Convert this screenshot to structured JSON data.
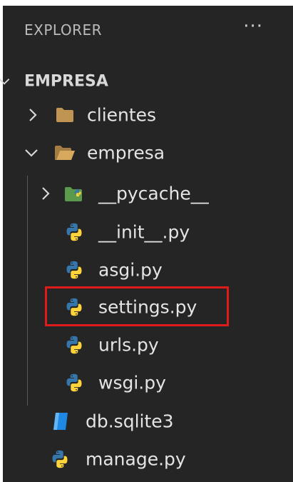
{
  "header": {
    "title": "EXPLORER",
    "more_label": "···"
  },
  "tree": {
    "root": {
      "label": "EMPRESA",
      "expanded": true
    },
    "items": [
      {
        "label": "clientes",
        "type": "folder",
        "expanded": false
      },
      {
        "label": "empresa",
        "type": "folder",
        "expanded": true
      },
      {
        "label": "__pycache__",
        "type": "folder",
        "expanded": false
      },
      {
        "label": "__init__.py",
        "type": "python-file"
      },
      {
        "label": "asgi.py",
        "type": "python-file"
      },
      {
        "label": "settings.py",
        "type": "python-file",
        "highlighted": true
      },
      {
        "label": "urls.py",
        "type": "python-file"
      },
      {
        "label": "wsgi.py",
        "type": "python-file"
      },
      {
        "label": "db.sqlite3",
        "type": "database-file"
      },
      {
        "label": "manage.py",
        "type": "python-file"
      }
    ]
  },
  "colors": {
    "panel": "#252526",
    "text": "#e4e4e4",
    "folder": "#c09553",
    "python_blue": "#3776ab",
    "python_yellow": "#ffd43b",
    "highlight_box": "#e01b1b",
    "sqlite": "#1e88e5"
  }
}
